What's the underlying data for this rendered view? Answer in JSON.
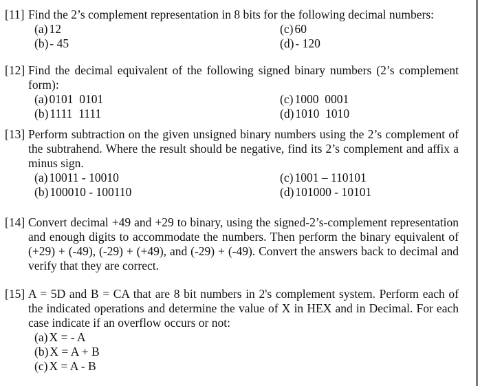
{
  "problems": [
    {
      "number": "[11]",
      "stem": "Find the 2’s complement representation in 8 bits for the following decimal numbers:",
      "items": [
        {
          "label": "(a)",
          "value": "12"
        },
        {
          "label": "(b)",
          "value": "- 45"
        },
        {
          "label": "(c)",
          "value": "60"
        },
        {
          "label": "(d)",
          "value": "- 120"
        }
      ]
    },
    {
      "number": "[12]",
      "stem": "Find the decimal equivalent of the following signed binary numbers (2’s complement form):",
      "items": [
        {
          "label": "(a)",
          "value": "0101  0101"
        },
        {
          "label": "(b)",
          "value": "1111  1111"
        },
        {
          "label": "(c)",
          "value": "1000  0001"
        },
        {
          "label": "(d)",
          "value": "1010  1010"
        }
      ]
    },
    {
      "number": "[13]",
      "stem": "Perform subtraction on the given unsigned binary numbers using the 2’s complement of the subtrahend. Where the result should be negative, find its 2’s complement and affix a minus sign.",
      "items": [
        {
          "label": "(a)",
          "value": "10011 - 10010"
        },
        {
          "label": "(b)",
          "value": "100010 - 100110"
        },
        {
          "label": "(c)",
          "value": "1001 – 110101"
        },
        {
          "label": "(d)",
          "value": "101000 - 10101"
        }
      ]
    },
    {
      "number": "[14]",
      "stem": "Convert decimal +49 and +29 to binary, using the signed-2’s-complement representation and enough digits to accommodate the numbers. Then perform the binary equivalent of (+29) + (-49), (-29) + (+49), and (-29) + (-49). Convert the answers back to decimal and verify that they are correct.",
      "items": []
    },
    {
      "number": "[15]",
      "stem": "A = 5D and B = CA that are 8 bit numbers in 2's complement system. Perform each of the indicated operations and determine the value of X in HEX and in Decimal. For each case indicate if an overflow occurs or not:",
      "items": [
        {
          "label": "(a)",
          "value": "X = - A"
        },
        {
          "label": "(b)",
          "value": "X = A + B"
        },
        {
          "label": "(c)",
          "value": "X = A - B"
        }
      ]
    }
  ]
}
